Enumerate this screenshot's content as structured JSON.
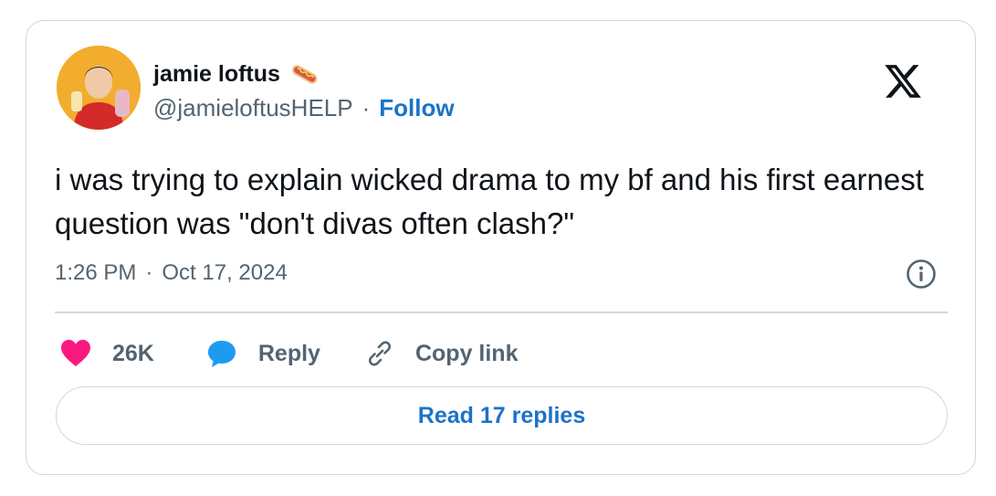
{
  "author": {
    "display_name": "jamie loftus",
    "name_emoji_icon": "hotdog-icon",
    "handle": "@jamieloftusHELP",
    "separator": "·",
    "follow_label": "Follow"
  },
  "tweet": {
    "text": "i was trying to explain wicked drama to my bf and his first earnest question was \"don't divas often clash?\"",
    "time": "1:26 PM",
    "separator": "·",
    "date": "Oct 17, 2024"
  },
  "actions": {
    "likes": "26K",
    "reply_label": "Reply",
    "copy_link_label": "Copy link"
  },
  "read_replies_label": "Read 17 replies",
  "colors": {
    "accent": "#1d72c9",
    "like": "#f91880",
    "reply_icon": "#1d9bf0",
    "secondary_text": "#536471",
    "border": "#cfd9de"
  }
}
